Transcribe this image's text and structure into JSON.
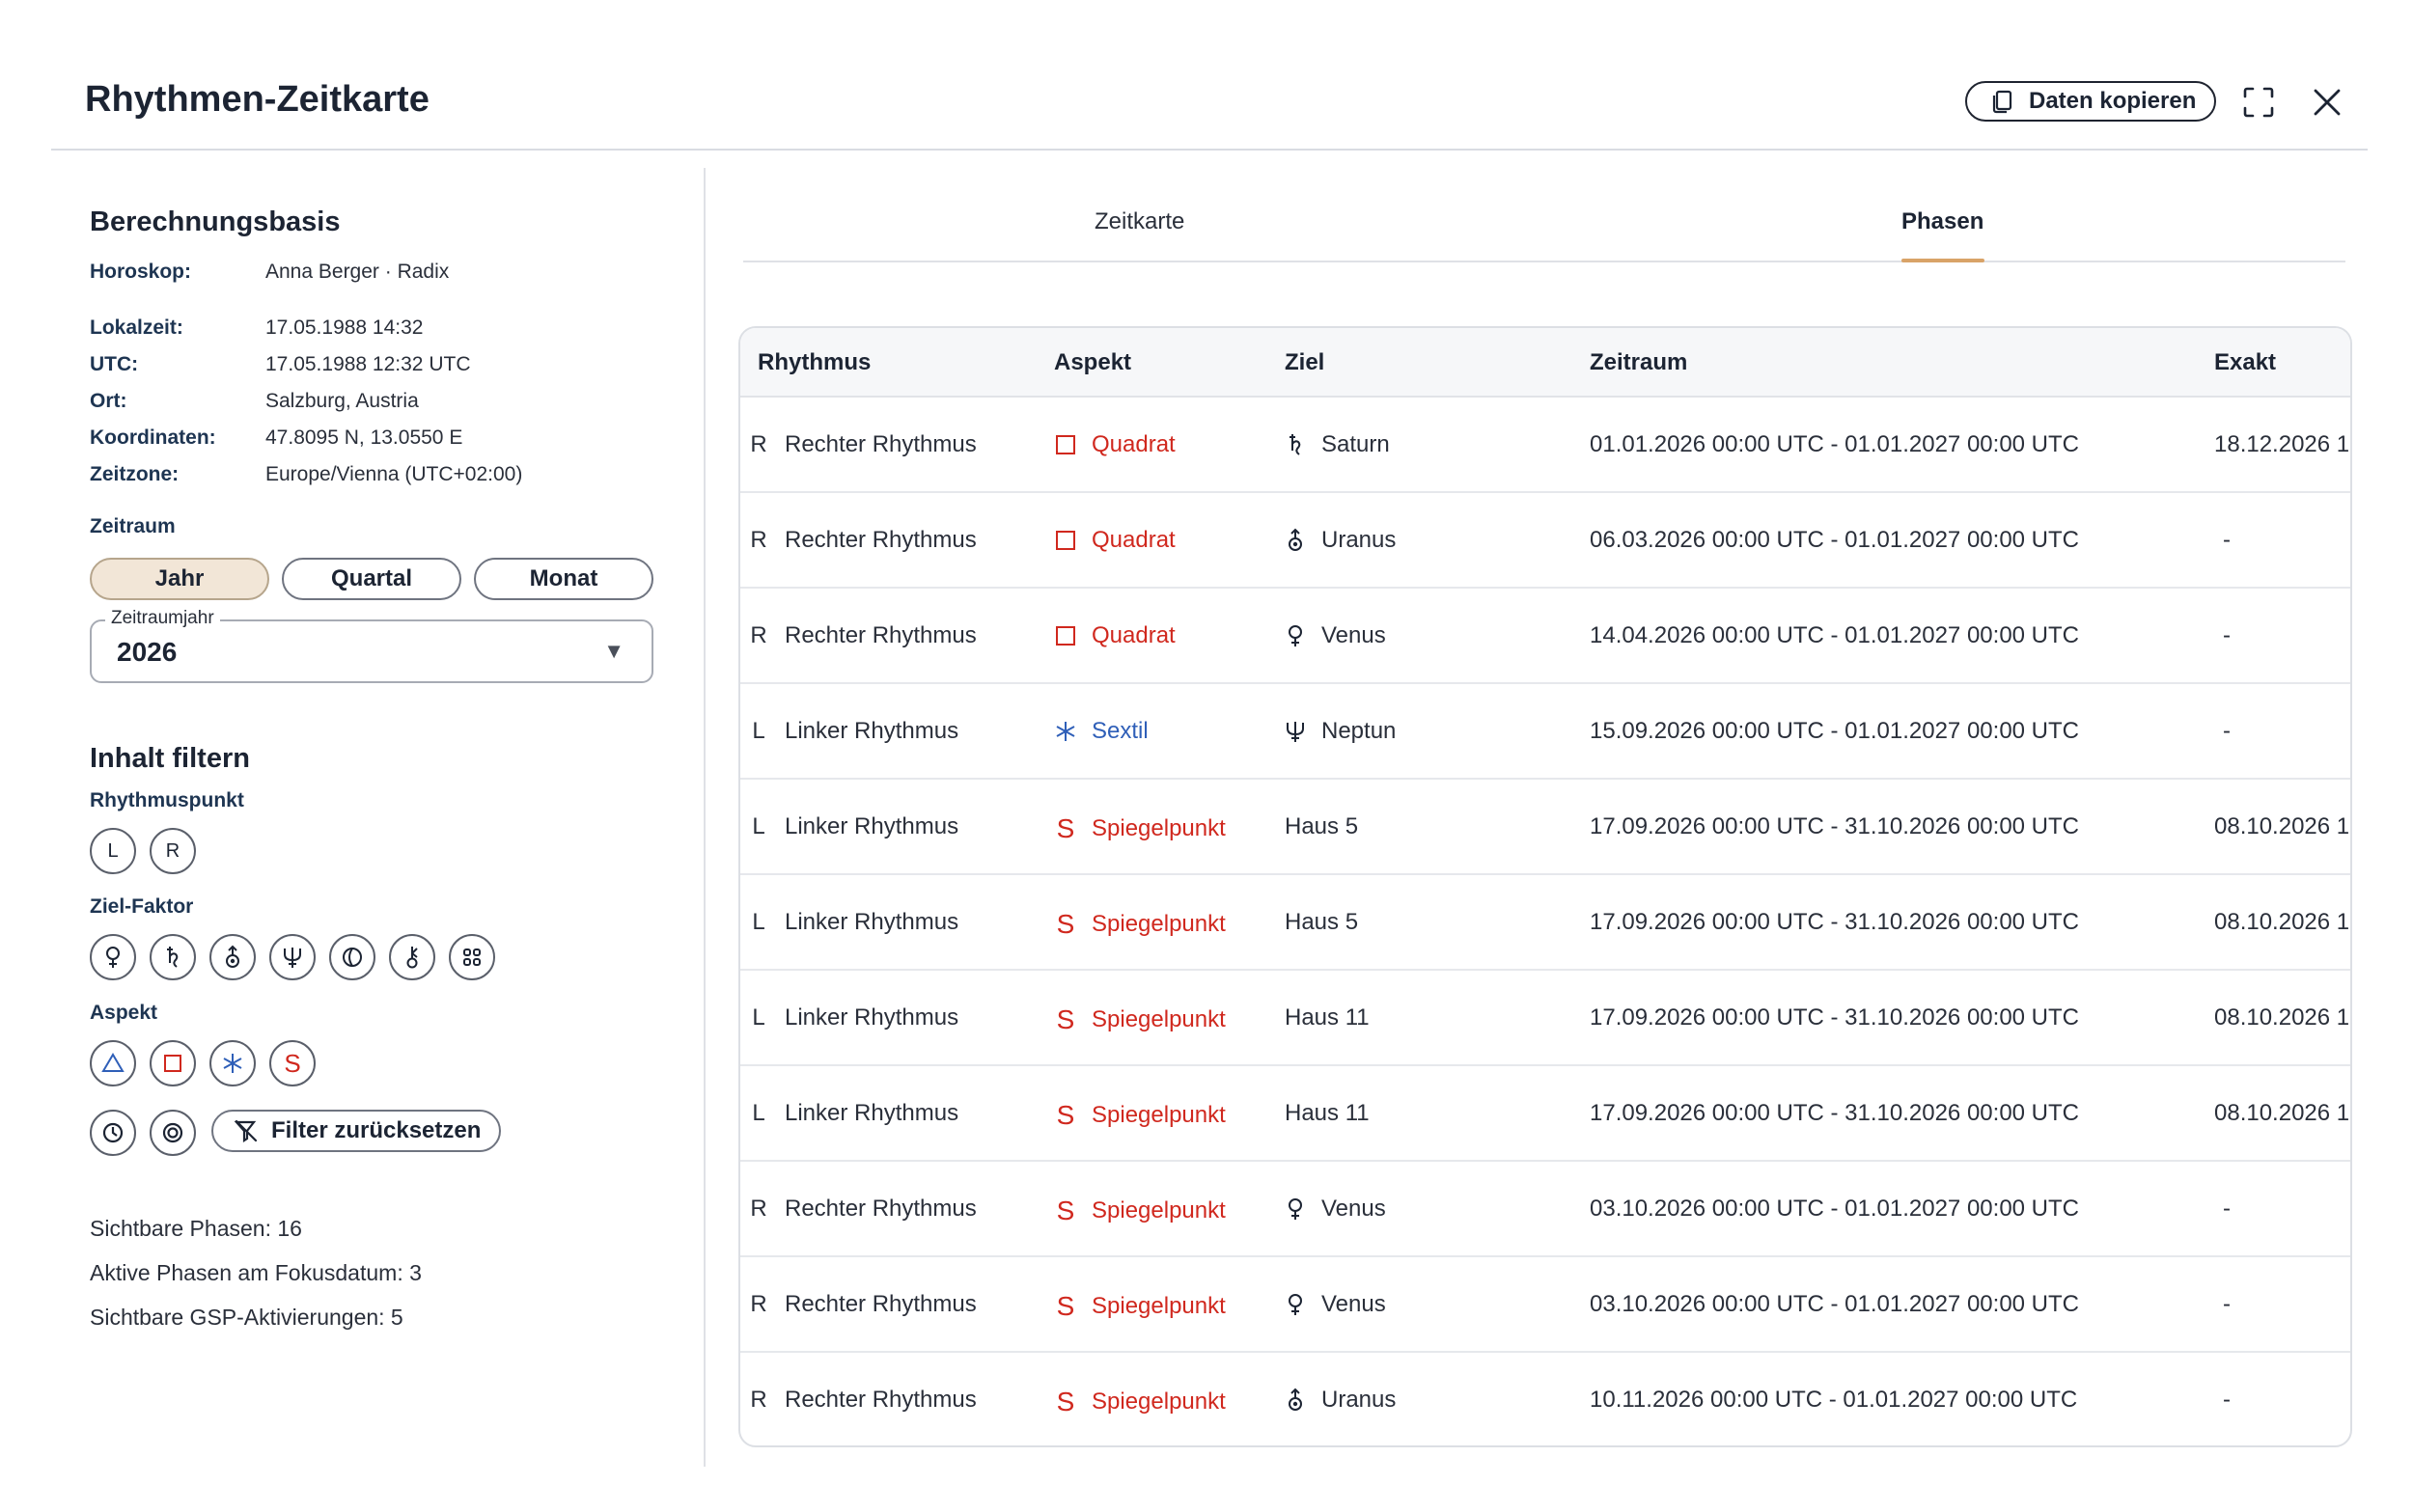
{
  "header": {
    "title": "Rhythmen-Zeitkarte",
    "copy_label": "Daten kopieren"
  },
  "basis": {
    "title": "Berechnungsbasis",
    "rows": [
      {
        "label": "Horoskop:",
        "value": "Anna Berger · Radix"
      },
      {
        "label": "Lokalzeit:",
        "value": "17.05.1988 14:32"
      },
      {
        "label": "UTC:",
        "value": "17.05.1988 12:32 UTC"
      },
      {
        "label": "Ort:",
        "value": "Salzburg, Austria"
      },
      {
        "label": "Koordinaten:",
        "value": "47.8095 N, 13.0550 E"
      },
      {
        "label": "Zeitzone:",
        "value": "Europe/Vienna (UTC+02:00)"
      }
    ]
  },
  "zeitraum": {
    "label": "Zeitraum",
    "options": [
      "Jahr",
      "Quartal",
      "Monat"
    ],
    "selected": "Jahr",
    "select_legend": "Zeitraumjahr",
    "select_value": "2026",
    "select_arrow": "▼"
  },
  "filter": {
    "title": "Inhalt filtern",
    "rhythm_label": "Rhythmuspunkt",
    "rhythm_options": [
      "L",
      "R"
    ],
    "target_label": "Ziel-Faktor",
    "aspect_label": "Aspekt",
    "aspect_s": "S",
    "reset_label": "Filter zurücksetzen"
  },
  "stats": {
    "visible_phases": "Sichtbare Phasen: 16",
    "active_phases": "Aktive Phasen am Fokusdatum: 3",
    "gsp_activations": "Sichtbare GSP-Aktivierungen: 5"
  },
  "tabs": [
    {
      "label": "Zeitkarte",
      "active": false
    },
    {
      "label": "Phasen",
      "active": true
    }
  ],
  "table": {
    "headers": [
      "Rhythmus",
      "Aspekt",
      "Ziel",
      "Zeitraum",
      "Exakt"
    ],
    "rows": [
      {
        "letter": "R",
        "rhythm": "Rechter Rhythmus",
        "aspect_icon": "square-icon",
        "aspect": "Quadrat",
        "target_icon": "saturn-icon",
        "target": "Saturn",
        "period": "01.01.2026 00:00 UTC - 01.01.2027 00:00 UTC",
        "exact": "18.12.2026 1"
      },
      {
        "letter": "R",
        "rhythm": "Rechter Rhythmus",
        "aspect_icon": "square-icon",
        "aspect": "Quadrat",
        "target_icon": "uranus-icon",
        "target": "Uranus",
        "period": "06.03.2026 00:00 UTC - 01.01.2027 00:00 UTC",
        "exact": "-"
      },
      {
        "letter": "R",
        "rhythm": "Rechter Rhythmus",
        "aspect_icon": "square-icon",
        "aspect": "Quadrat",
        "target_icon": "venus-icon",
        "target": "Venus",
        "period": "14.04.2026 00:00 UTC - 01.01.2027 00:00 UTC",
        "exact": "-"
      },
      {
        "letter": "L",
        "rhythm": "Linker Rhythmus",
        "aspect_icon": "sextile-icon",
        "aspect": "Sextil",
        "target_icon": "neptune-icon",
        "target": "Neptun",
        "period": "15.09.2026 00:00 UTC - 01.01.2027 00:00 UTC",
        "exact": "-"
      },
      {
        "letter": "L",
        "rhythm": "Linker Rhythmus",
        "aspect_icon": "s-icon",
        "aspect": "Spiegelpunkt",
        "target_icon": "",
        "target": "Haus 5",
        "period": "17.09.2026 00:00 UTC - 31.10.2026 00:00 UTC",
        "exact": "08.10.2026 1"
      },
      {
        "letter": "L",
        "rhythm": "Linker Rhythmus",
        "aspect_icon": "s-icon",
        "aspect": "Spiegelpunkt",
        "target_icon": "",
        "target": "Haus 5",
        "period": "17.09.2026 00:00 UTC - 31.10.2026 00:00 UTC",
        "exact": "08.10.2026 1"
      },
      {
        "letter": "L",
        "rhythm": "Linker Rhythmus",
        "aspect_icon": "s-icon",
        "aspect": "Spiegelpunkt",
        "target_icon": "",
        "target": "Haus 11",
        "period": "17.09.2026 00:00 UTC - 31.10.2026 00:00 UTC",
        "exact": "08.10.2026 1"
      },
      {
        "letter": "L",
        "rhythm": "Linker Rhythmus",
        "aspect_icon": "s-icon",
        "aspect": "Spiegelpunkt",
        "target_icon": "",
        "target": "Haus 11",
        "period": "17.09.2026 00:00 UTC - 31.10.2026 00:00 UTC",
        "exact": "08.10.2026 1"
      },
      {
        "letter": "R",
        "rhythm": "Rechter Rhythmus",
        "aspect_icon": "s-icon",
        "aspect": "Spiegelpunkt",
        "target_icon": "venus-icon",
        "target": "Venus",
        "period": "03.10.2026 00:00 UTC - 01.01.2027 00:00 UTC",
        "exact": "-"
      },
      {
        "letter": "R",
        "rhythm": "Rechter Rhythmus",
        "aspect_icon": "s-icon",
        "aspect": "Spiegelpunkt",
        "target_icon": "venus-icon",
        "target": "Venus",
        "period": "03.10.2026 00:00 UTC - 01.01.2027 00:00 UTC",
        "exact": "-"
      },
      {
        "letter": "R",
        "rhythm": "Rechter Rhythmus",
        "aspect_icon": "s-icon",
        "aspect": "Spiegelpunkt",
        "target_icon": "uranus-icon",
        "target": "Uranus",
        "period": "10.11.2026 00:00 UTC - 01.01.2027 00:00 UTC",
        "exact": "-"
      }
    ]
  },
  "colors": {
    "accent": "#d9a368",
    "aspect_red": "#d0281e",
    "aspect_blue": "#2f5fb8",
    "segment_active": "#f2e6d7"
  }
}
